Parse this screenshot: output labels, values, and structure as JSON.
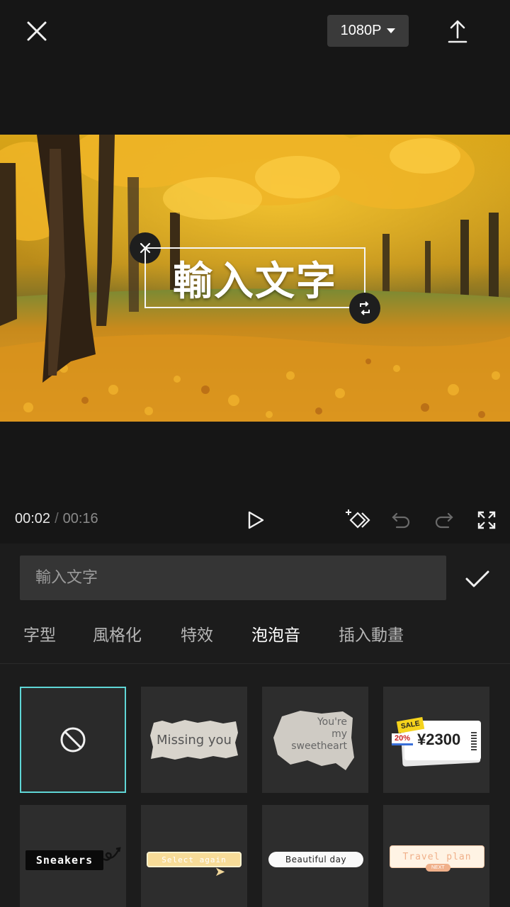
{
  "header": {
    "resolution_label": "1080P"
  },
  "preview": {
    "overlay_text": "輸入文字"
  },
  "playback": {
    "current_time": "00:02",
    "separator": "/",
    "total_time": "00:16"
  },
  "editor": {
    "input_placeholder": "輸入文字",
    "input_value": ""
  },
  "tabs": [
    {
      "label": "字型"
    },
    {
      "label": "風格化"
    },
    {
      "label": "特效"
    },
    {
      "label": "泡泡音",
      "active": true
    },
    {
      "label": "插入動畫"
    }
  ],
  "bubbles": [
    {
      "id": "none",
      "selected": true
    },
    {
      "text": "Missing you"
    },
    {
      "text": "You're my sweetheart",
      "lines": [
        "You're",
        "my",
        "sweetheart"
      ]
    },
    {
      "badge_sale": "SALE",
      "badge_pct": "20%",
      "price": "¥2300"
    },
    {
      "text": "Sneakers"
    },
    {
      "text": "Select again"
    },
    {
      "text": "Beautiful day"
    },
    {
      "text": "Travel plan",
      "badge": "NEXT"
    }
  ],
  "colors": {
    "background": "#161616",
    "panel": "#1c1c1c",
    "tile": "#2d2d2d",
    "selection": "#5fd6d6",
    "resolution_button": "#3a3a3a"
  },
  "icons": [
    "close-icon",
    "chevron-down-icon",
    "export-icon",
    "play-icon",
    "keyframe-icon",
    "undo-icon",
    "redo-icon",
    "fullscreen-icon",
    "check-icon",
    "no-entry-icon",
    "delete-icon",
    "rotate-icon"
  ]
}
